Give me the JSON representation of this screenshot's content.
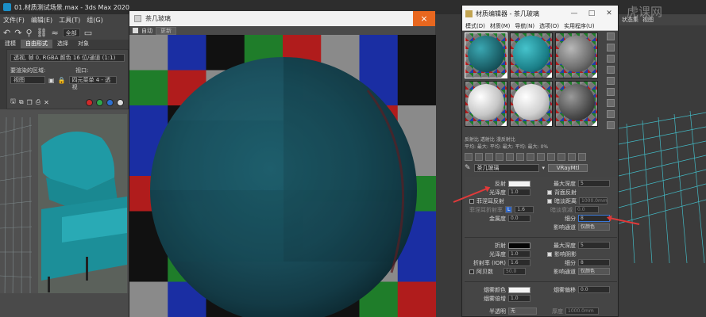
{
  "max": {
    "title": "01.材质测试场景.max - 3ds Max 2020",
    "menu": [
      "文件(F)",
      "编辑(E)",
      "工具(T)",
      "组(G)"
    ],
    "toolbar_combo": "全部",
    "ribbon": [
      "建模",
      "自由形式",
      "选择",
      "对象"
    ],
    "ribbon_active": "自由形式",
    "render_panel": {
      "channel": "透视, 帧 0, RGBA 颜色 16 位/通道 (1:1)",
      "area_label": "要渲染的区域:",
      "area_value": "视图",
      "viewport_label": "视口:",
      "viewport_value": "四元菜单 4 - 透视"
    }
  },
  "render_window": {
    "title": "茶几玻璃",
    "auto_label": "自动",
    "update_label": "更新",
    "close_glyph": "×"
  },
  "mat_editor": {
    "title": "材质编辑器 - 茶几玻璃",
    "window_buttons": [
      "—",
      "□",
      "✕"
    ],
    "menu": [
      "模式(D)",
      "材质(M)",
      "导航(N)",
      "选项(O)",
      "实用程序(U)"
    ],
    "info_row1": "反射比          透射比          漫反射比",
    "info_row2": "平均:    最大:    平均:    最大:    平均:    最大: 0%",
    "slot_name": "茶几玻璃",
    "slot_type": "VRayMtl",
    "params": {
      "reflect": "反射",
      "gloss": "光泽度",
      "gloss_val": "1.0",
      "fresnel": "菲涅耳反射",
      "fresnel_ior": "菲涅耳折射率",
      "fresnel_ior_lock": "L",
      "fresnel_ior_val": "1.6",
      "metal": "金属度",
      "metal_val": "0.0",
      "max_depth": "最大深度",
      "max_depth_val": "5",
      "back_reflect": "背面反射",
      "dim_distance": "暗淡距离",
      "dim_distance_val": "1000.0mm",
      "dim_falloff": "暗淡衰减",
      "dim_falloff_val": "0.0",
      "subdivs": "细分",
      "subdivs_val": "8",
      "affect_channels": "影响通道",
      "affect_channels_val": "仅颜色",
      "refract": "折射",
      "refr_gloss": "光泽度",
      "refr_gloss_val": "1.0",
      "ior": "折射率 (IOR)",
      "ior_val": "1.6",
      "abbe": "阿贝数",
      "abbe_val": "50.0",
      "refr_max_depth": "最大深度",
      "refr_max_depth_val": "5",
      "affect_shadows": "影响阴影",
      "refr_subdivs": "细分",
      "refr_subdivs_val": "8",
      "refr_affect": "影响通道",
      "refr_affect_val": "仅颜色",
      "fog_color": "烟雾颜色",
      "fog_bias": "烟雾偏移",
      "fog_bias_val": "0.0",
      "fog_mult": "烟雾倍增",
      "fog_mult_val": "1.0",
      "translucency": "半透明",
      "translucency_val": "无",
      "thickness": "厚度",
      "thickness_val": "1000.0mm"
    }
  },
  "right": {
    "toolbar": [
      "状态集",
      "视图"
    ]
  },
  "watermark": "虎课网",
  "colors": {
    "teal": "#1f8a93",
    "render_bg_red": "#b01c1c",
    "render_bg_green": "#1f7d2a",
    "render_bg_blue": "#1a2ea3",
    "render_bg_gray": "#8a8a8a",
    "render_bg_black": "#111111",
    "close_orange": "#e8671f",
    "annotation_red": "#e03a3a"
  }
}
